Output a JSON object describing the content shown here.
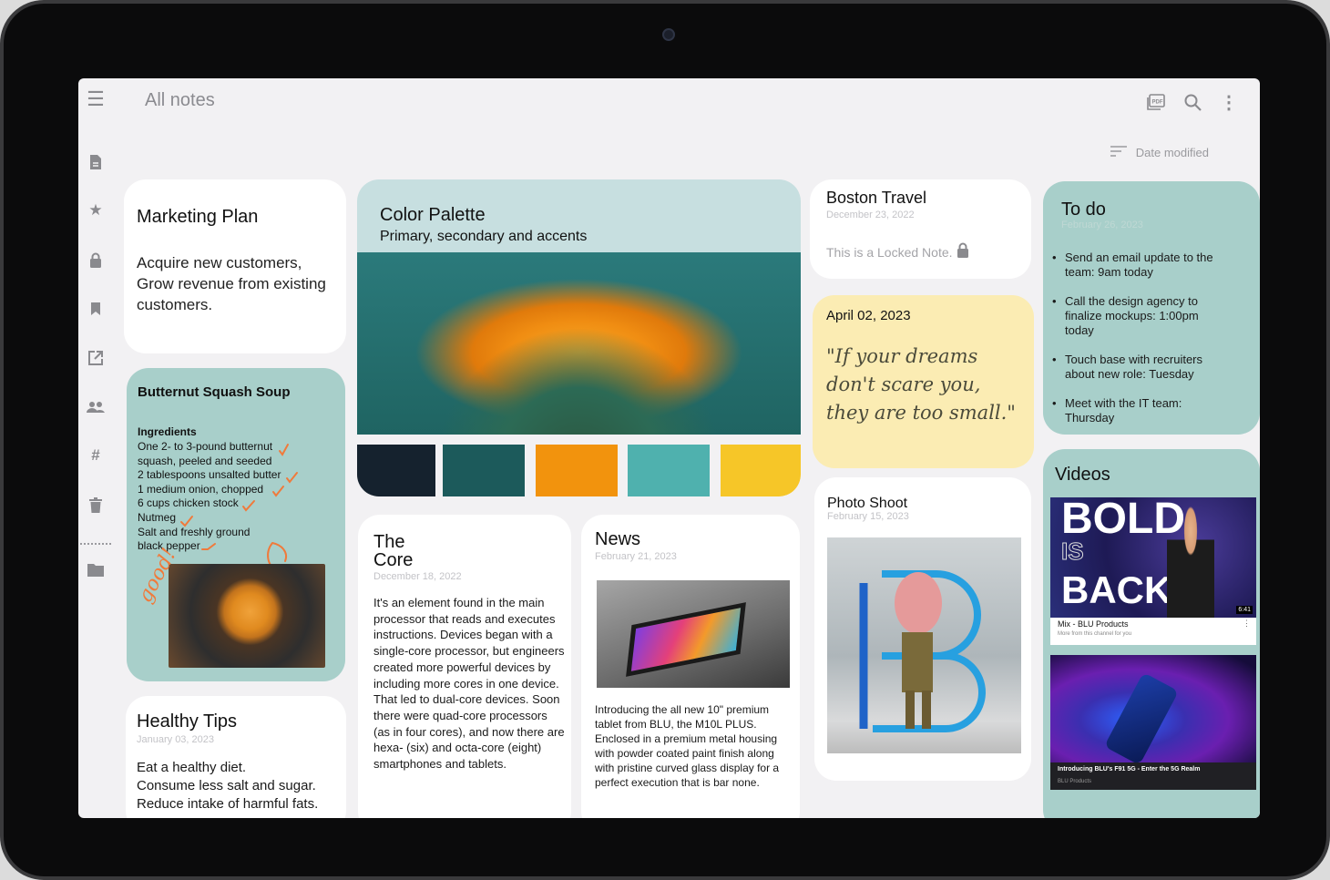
{
  "app": {
    "title": "All notes"
  },
  "sort": {
    "label": "Date modified"
  },
  "colors": {
    "accent": "#a8cfca",
    "yellow_card": "#fbecb3",
    "background": "#f2f1f3",
    "check": "#f07a3b"
  },
  "icons": {
    "rail": [
      "menu-icon",
      "new-note-icon",
      "star-icon",
      "lock-icon",
      "bookmark-icon",
      "share-icon",
      "shared-people-icon",
      "hashtag-icon",
      "trash-icon",
      "folder-icon"
    ],
    "top": [
      "pdf-icon",
      "search-icon",
      "more-icon"
    ]
  },
  "notes": {
    "marketing": {
      "title": "Marketing Plan",
      "body": "Acquire new customers, Grow revenue from existing customers."
    },
    "soup": {
      "title": "Butternut Squash Soup",
      "heading": "Ingredients",
      "items": [
        "One 2- to 3-pound butternut",
        "squash, peeled and seeded",
        "2 tablespoons unsalted butter",
        "1 medium onion, chopped",
        "6 cups chicken stock",
        "Nutmeg",
        "Salt and freshly ground",
        "black pepper"
      ],
      "handwriting": "good!"
    },
    "healthy": {
      "title": "Healthy Tips",
      "date": "January 03, 2023",
      "lines": [
        "Eat a healthy diet.",
        "Consume less salt and sugar.",
        "Reduce intake of harmful fats."
      ]
    },
    "palette": {
      "title": "Color Palette",
      "subtitle": "Primary, secondary and accents",
      "swatches": [
        "#15222e",
        "#1c5a5b",
        "#f2930d",
        "#4fb1ae",
        "#f6c628"
      ]
    },
    "core": {
      "title": "The Core",
      "date": "December 18, 2022",
      "body": "It's an element found in the main processor that reads and executes instructions. Devices began with a single-core processor, but engineers created more powerful devices by including more cores in one device. That led to dual-core devices. Soon there were quad-core processors (as in four cores), and now there are hexa- (six) and octa-core (eight) smartphones and tablets."
    },
    "news": {
      "title": "News",
      "date": "February 21, 2023",
      "body": "Introducing the all new 10\" premium tablet from BLU, the M10L PLUS. Enclosed in a premium metal housing with powder coated paint finish along with pristine curved glass display for a perfect execution that is bar none."
    },
    "boston": {
      "title": "Boston Travel",
      "date": "December 23, 2022",
      "locked_text": "This is a Locked Note."
    },
    "quote": {
      "date": "April 02, 2023",
      "text": "\"If your dreams don't scare you, they are too small.\""
    },
    "photo": {
      "title": "Photo Shoot",
      "date": "February 15, 2023"
    },
    "todo": {
      "title": "To do",
      "date": "February 26, 2023",
      "items": [
        "Send an email update to the team: 9am today",
        "Call the design agency to finalize mockups: 1:00pm today",
        "Touch base with recruiters about new role: Tuesday",
        "Meet with the IT team: Thursday"
      ]
    },
    "videos": {
      "title": "Videos",
      "v1": {
        "thumb_line1": "BOLD",
        "thumb_line2": "IS",
        "thumb_line3": "BACK",
        "duration": "6:41",
        "caption": "Mix - BLU Products",
        "sub": "More from this channel for you"
      },
      "v2": {
        "caption": "Introducing BLU's F91 5G - Enter the 5G Realm",
        "sub": "BLU Products"
      }
    }
  }
}
